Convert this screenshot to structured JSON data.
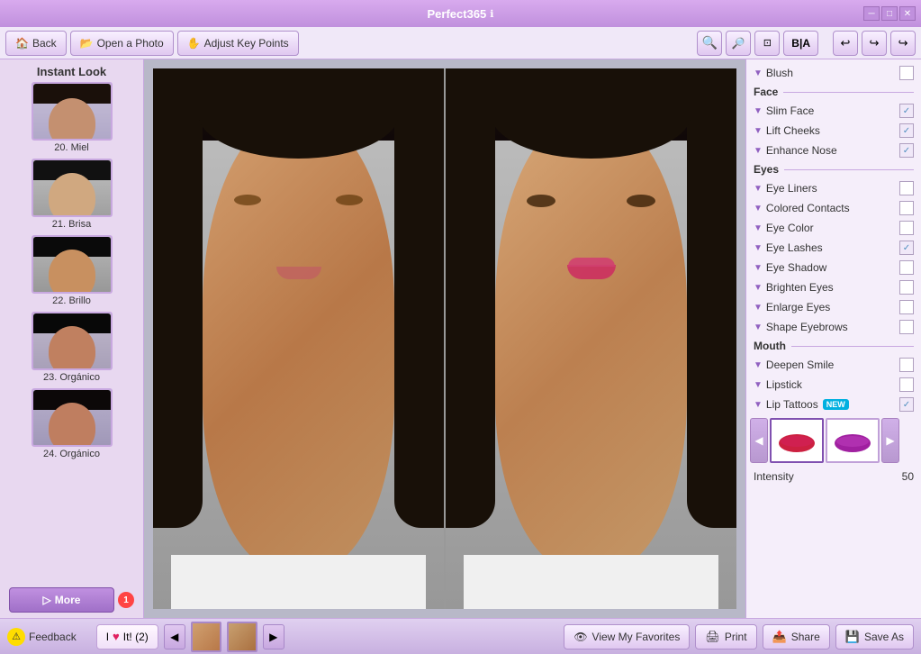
{
  "app": {
    "title": "Perfect365",
    "version_icon": "ℹ"
  },
  "win_controls": {
    "minimize": "─",
    "maximize": "□",
    "close": "✕"
  },
  "toolbar": {
    "back_label": "Back",
    "open_photo_label": "Open a Photo",
    "adjust_key_points_label": "Adjust Key Points",
    "zoom_in": "🔍",
    "zoom_out": "🔍",
    "fit_label": "⊡",
    "bia_label": "B|A",
    "undo": "↩",
    "redo_l": "↪",
    "redo_r": "↪"
  },
  "left_panel": {
    "header": "Instant Look",
    "looks": [
      {
        "number": 20,
        "label": "20. Miel"
      },
      {
        "number": 21,
        "label": "21. Brisa"
      },
      {
        "number": 22,
        "label": "22. Brillo"
      },
      {
        "number": 23,
        "label": "23. Orgánico"
      },
      {
        "number": 24,
        "label": "24. Orgánico"
      }
    ],
    "more_label": "More",
    "more_badge": "1"
  },
  "right_panel": {
    "blush_label": "Blush",
    "blush_checked": false,
    "face_section": "Face",
    "face_items": [
      {
        "label": "Slim Face",
        "checked": true
      },
      {
        "label": "Lift Cheeks",
        "checked": true
      },
      {
        "label": "Enhance Nose",
        "checked": true
      }
    ],
    "eyes_section": "Eyes",
    "eyes_items": [
      {
        "label": "Eye Liners",
        "checked": false
      },
      {
        "label": "Colored Contacts",
        "checked": false
      },
      {
        "label": "Eye Color",
        "checked": false
      },
      {
        "label": "Eye Lashes",
        "checked": true
      },
      {
        "label": "Eye Shadow",
        "checked": false
      },
      {
        "label": "Brighten Eyes",
        "checked": false
      },
      {
        "label": "Enlarge Eyes",
        "checked": false
      },
      {
        "label": "Shape Eyebrows",
        "checked": false
      }
    ],
    "mouth_section": "Mouth",
    "mouth_items": [
      {
        "label": "Deepen Smile",
        "checked": false
      },
      {
        "label": "Lipstick",
        "checked": false
      },
      {
        "label": "Lip Tattoos",
        "checked": true,
        "new_badge": true
      }
    ],
    "intensity_label": "Intensity",
    "intensity_value": "50"
  },
  "bottom_bar": {
    "feedback_label": "Feedback",
    "like_label": "I",
    "like_heart": "♥",
    "like_it_label": "It! (2)",
    "prev_arrow": "◀",
    "next_arrow": "▶",
    "view_favorites_label": "View My Favorites",
    "print_label": "Print",
    "share_label": "Share",
    "save_as_label": "Save As"
  }
}
